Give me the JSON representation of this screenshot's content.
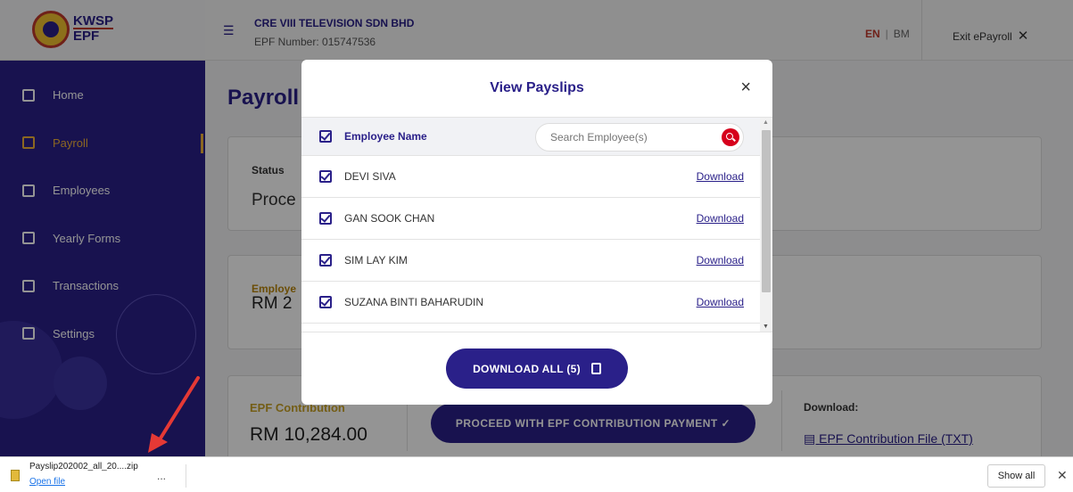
{
  "logo": {
    "line1": "KWSP",
    "line2": "EPF"
  },
  "sidebar": {
    "items": [
      {
        "label": "Home",
        "icon": "grid-icon"
      },
      {
        "label": "Payroll",
        "icon": "payroll-icon"
      },
      {
        "label": "Employees",
        "icon": "people-icon"
      },
      {
        "label": "Yearly Forms",
        "icon": "form-icon"
      },
      {
        "label": "Transactions",
        "icon": "coin-icon"
      },
      {
        "label": "Settings",
        "icon": "gear-icon"
      }
    ],
    "active_index": 1
  },
  "header": {
    "company": "CRE VIII TELEVISION SDN BHD",
    "epf_number": "EPF Number: 015747536",
    "lang_en": "EN",
    "lang_sep": "|",
    "lang_bm": "BM",
    "exit_label": "Exit ePayroll",
    "exit_icon": "✕"
  },
  "main": {
    "page_title": "Payroll",
    "status_label": "Status",
    "status_value": "Proce",
    "employee_label": "Employe",
    "employee_value": "RM 2",
    "epf_label": "EPF Contribution",
    "epf_value": "RM 10,284.00",
    "proceed_button": "PROCEED WITH EPF CONTRIBUTION PAYMENT  ✓",
    "download_label": "Download:",
    "download_link": "EPF Contribution File (TXT)"
  },
  "modal": {
    "title": "View Payslips",
    "close": "×",
    "header_name": "Employee Name",
    "search_placeholder": "Search Employee(s)",
    "rows": [
      {
        "name": "DEVI SIVA",
        "action": "Download"
      },
      {
        "name": "GAN SOOK CHAN",
        "action": "Download"
      },
      {
        "name": "SIM LAY KIM",
        "action": "Download"
      },
      {
        "name": "SUZANA BINTI BAHARUDIN",
        "action": "Download"
      }
    ],
    "download_all": "DOWNLOAD ALL (5)"
  },
  "download_bar": {
    "filename": "Payslip202002_all_20....zip",
    "open_label": "Open file",
    "more": "...",
    "show_all": "Show all",
    "close": "✕"
  },
  "colors": {
    "brand": "#2a2089",
    "accent": "#f0b13a",
    "danger": "#d6001c"
  }
}
